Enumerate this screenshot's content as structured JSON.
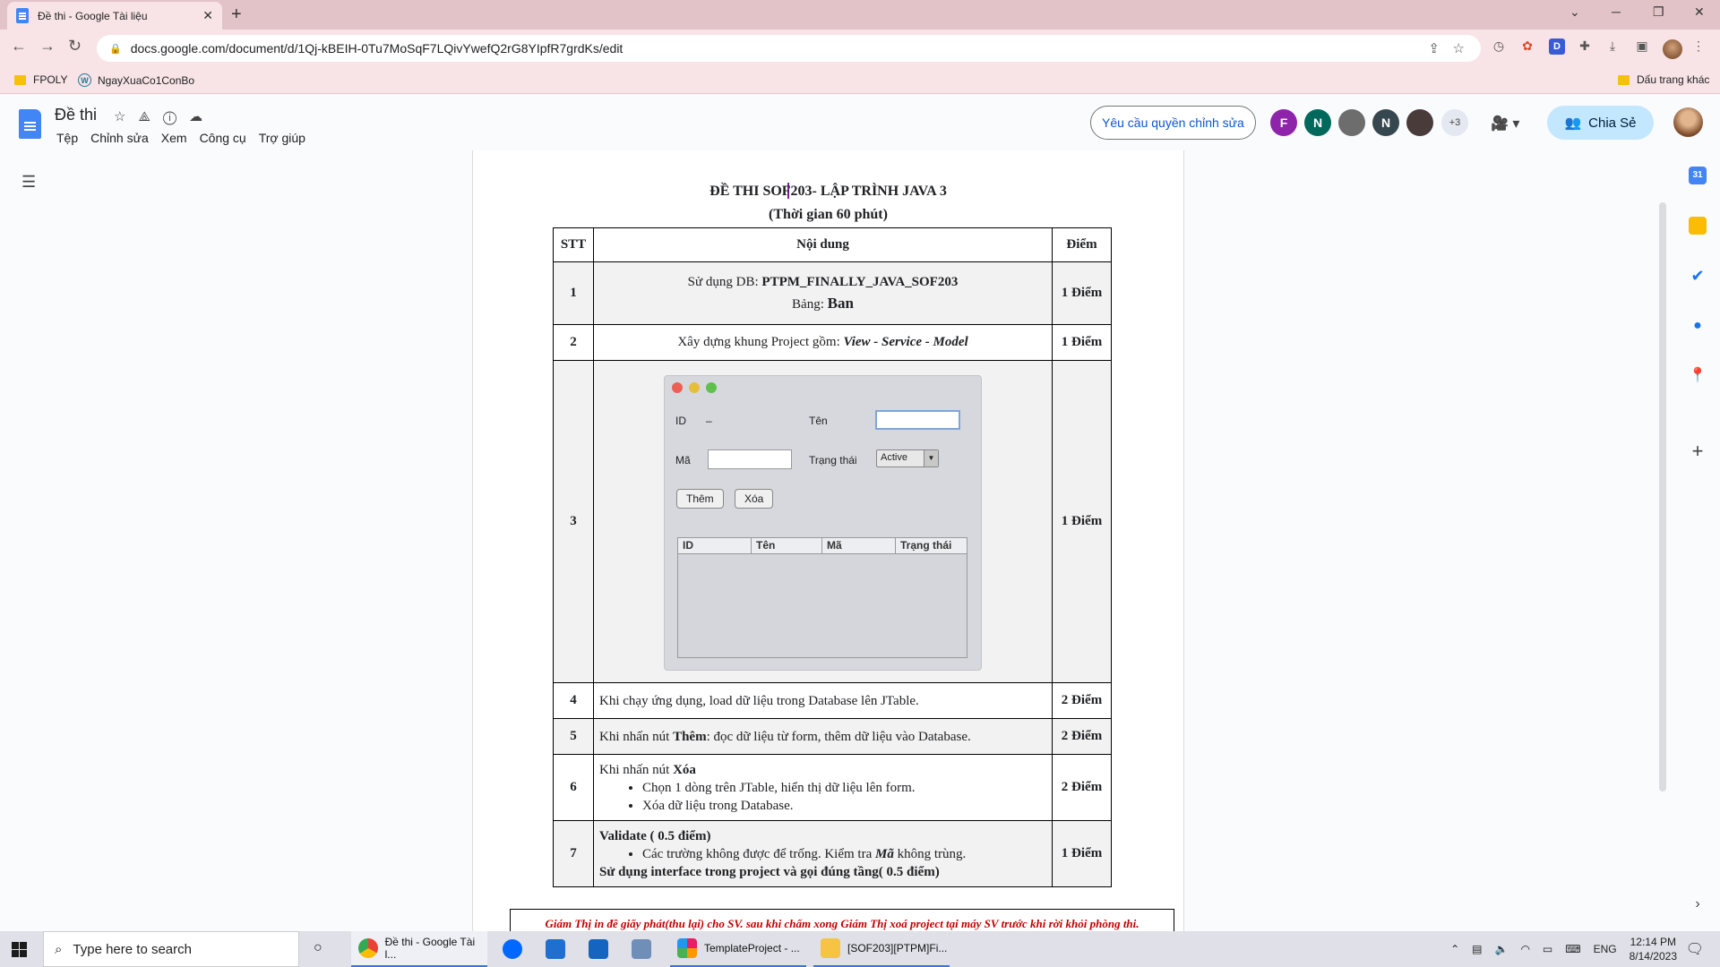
{
  "browser": {
    "tab_title": "Đề thi - Google Tài liệu",
    "tab_close": "✕",
    "new_tab": "+",
    "url": "docs.google.com/document/d/1Qj-kBEIH-0Tu7MoSqF7LQivYwefQ2rG8YIpfR7grdKs/edit",
    "bookmarks": [
      "FPOLY",
      "NgayXuaCo1ConBo"
    ],
    "other_bookmarks": "Dấu trang khác"
  },
  "docs": {
    "title": "Đề thi",
    "menu": [
      "Tệp",
      "Chỉnh sửa",
      "Xem",
      "Công cụ",
      "Trợ giúp"
    ],
    "request_edit": "Yêu cầu quyền chỉnh sửa",
    "share": "Chia Sẻ",
    "avatars": [
      {
        "letter": "F",
        "color": "#8e24aa"
      },
      {
        "letter": "N",
        "color": "#00695c"
      },
      {
        "letter": "",
        "color": "#6d6d6d"
      },
      {
        "letter": "N",
        "color": "#37474f"
      },
      {
        "letter": "",
        "color": "#4a3b3b"
      }
    ],
    "more_avatars": "+3"
  },
  "document": {
    "title": "ĐỀ THI SOF203- LẬP TRÌNH JAVA 3",
    "subtitle": "(Thời gian 60  phút)",
    "headers": {
      "stt": "STT",
      "content": "Nội dung",
      "points": "Điểm"
    },
    "row1": {
      "stt": "1",
      "line1_prefix": "Sử dụng DB: ",
      "db": "PTPM_FINALLY_JAVA_SOF203",
      "line2_prefix": "Bảng: ",
      "table": "Ban",
      "points": "1 Điểm"
    },
    "row2": {
      "stt": "2",
      "prefix": "Xây dựng khung Project gồm: ",
      "emph": "View - Service - Model",
      "points": "1 Điểm"
    },
    "row3": {
      "stt": "3",
      "points": "1 Điểm"
    },
    "row4": {
      "stt": "4",
      "text": "Khi chạy ứng dụng, load dữ liệu trong Database lên JTable.",
      "points": "2 Điểm"
    },
    "row5": {
      "stt": "5",
      "prefix": "Khi nhấn nút ",
      "bold": "Thêm",
      "suffix": ": đọc dữ liệu từ form, thêm dữ liệu vào Database.",
      "points": "2 Điểm"
    },
    "row6": {
      "stt": "6",
      "prefix": "Khi nhấn nút ",
      "bold": "Xóa",
      "bullets": [
        "Chọn 1 dòng trên JTable, hiển thị dữ liệu lên form.",
        "Xóa dữ liệu trong Database."
      ],
      "points": "2 Điểm"
    },
    "row7": {
      "stt": "7",
      "head": "Validate ( 0.5 điểm)",
      "bullet_prefix": "Các trường không được để trống. Kiểm tra ",
      "bullet_emph": "Mã",
      "bullet_suffix": " không trùng.",
      "tail": "Sử dụng interface trong project và gọi đúng tầng( 0.5 điểm)",
      "points": "1 Điểm"
    },
    "note": "Giám Thị in đề giấy phát(thu lại) cho SV. sau khi chấm xong Giám Thị xoá project tại máy SV trước khi rời khỏi phòng thi."
  },
  "mock_form": {
    "id_label": "ID",
    "id_value": "–",
    "name_label": "Tên",
    "code_label": "Mã",
    "status_label": "Trạng thái",
    "status_value": "Active",
    "add_button": "Thêm",
    "delete_button": "Xóa",
    "columns": [
      "ID",
      "Tên",
      "Mã",
      "Trạng thái"
    ]
  },
  "taskbar": {
    "search_placeholder": "Type here to search",
    "items": [
      "Đề thi - Google Tài l...",
      "TemplateProject - ...",
      "[SOF203][PTPM]Fi..."
    ],
    "lang": "ENG",
    "time": "12:14 PM",
    "date": "8/14/2023"
  }
}
